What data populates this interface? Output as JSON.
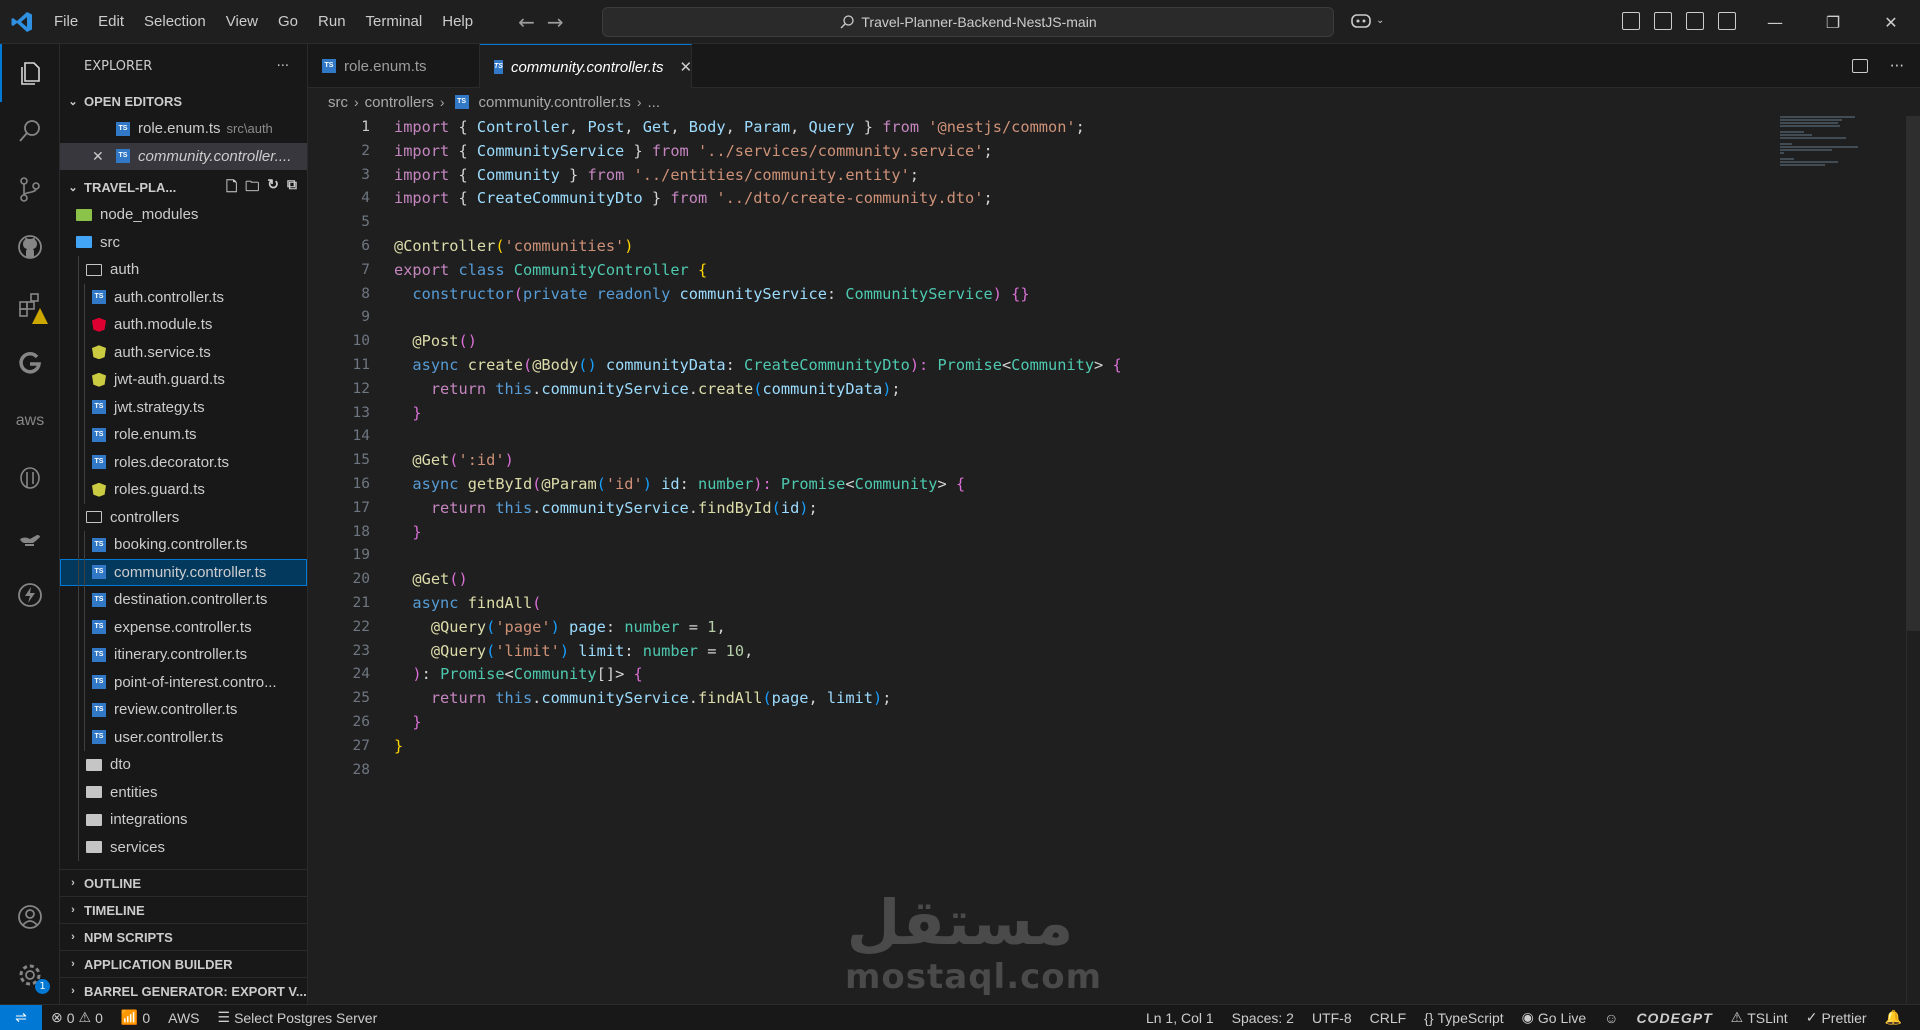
{
  "menu": [
    "File",
    "Edit",
    "Selection",
    "View",
    "Go",
    "Run",
    "Terminal",
    "Help"
  ],
  "command_center": "Travel-Planner-Backend-NestJS-main",
  "sidebar": {
    "title": "EXPLORER",
    "more": "···",
    "open_editors_label": "OPEN EDITORS",
    "open_editors": [
      {
        "name": "role.enum.ts",
        "desc": "src\\auth"
      },
      {
        "name": "community.controller...."
      }
    ],
    "project_label": "TRAVEL-PLA...",
    "tree": {
      "node_modules": "node_modules",
      "src": "src",
      "auth": "auth",
      "auth_files": [
        "auth.controller.ts",
        "auth.module.ts",
        "auth.service.ts",
        "jwt-auth.guard.ts",
        "jwt.strategy.ts",
        "role.enum.ts",
        "roles.decorator.ts",
        "roles.guard.ts"
      ],
      "controllers": "controllers",
      "controller_files": [
        "booking.controller.ts",
        "community.controller.ts",
        "destination.controller.ts",
        "expense.controller.ts",
        "itinerary.controller.ts",
        "point-of-interest.contro...",
        "review.controller.ts",
        "user.controller.ts"
      ],
      "dto": "dto",
      "entities": "entities",
      "integrations": "integrations",
      "services": "services"
    },
    "sections": [
      "OUTLINE",
      "TIMELINE",
      "NPM SCRIPTS",
      "APPLICATION BUILDER",
      "BARREL GENERATOR: EXPORT V..."
    ]
  },
  "tabs": [
    {
      "label": "role.enum.ts",
      "active": false
    },
    {
      "label": "community.controller.ts",
      "active": true
    }
  ],
  "breadcrumb": [
    "src",
    "controllers",
    "community.controller.ts",
    "..."
  ],
  "line_numbers": [
    "1",
    "2",
    "3",
    "4",
    "5",
    "6",
    "7",
    "8",
    "9",
    "10",
    "11",
    "12",
    "13",
    "14",
    "15",
    "16",
    "17",
    "18",
    "19",
    "20",
    "21",
    "22",
    "23",
    "24",
    "25",
    "26",
    "27",
    "28"
  ],
  "code": {
    "l1": {
      "a": "import",
      "b": " { ",
      "c": "Controller",
      "d": ", ",
      "e": "Post",
      "f": ", ",
      "g": "Get",
      "h": ", ",
      "i": "Body",
      "j": ", ",
      "k": "Param",
      "l": ", ",
      "m": "Query",
      "n": " } ",
      "o": "from",
      "p": " ",
      "q": "'@nestjs/common'",
      "r": ";"
    },
    "l2": {
      "a": "import",
      "b": " { ",
      "c": "CommunityService",
      "d": " } ",
      "e": "from",
      "f": " ",
      "g": "'../services/community.service'",
      "h": ";"
    },
    "l3": {
      "a": "import",
      "b": " { ",
      "c": "Community",
      "d": " } ",
      "e": "from",
      "f": " ",
      "g": "'../entities/community.entity'",
      "h": ";"
    },
    "l4": {
      "a": "import",
      "b": " { ",
      "c": "CreateCommunityDto",
      "d": " } ",
      "e": "from",
      "f": " ",
      "g": "'../dto/create-community.dto'",
      "h": ";"
    },
    "l6": {
      "a": "@",
      "b": "Controller",
      "c": "(",
      "d": "'communities'",
      "e": ")"
    },
    "l7": {
      "a": "export",
      "b": " ",
      "c": "class",
      "d": " ",
      "e": "CommunityController",
      "f": " ",
      "g": "{"
    },
    "l8": {
      "a": "  ",
      "b": "constructor",
      "c": "(",
      "d": "private",
      "e": " ",
      "f": "readonly",
      "g": " ",
      "h": "communityService",
      "i": ": ",
      "j": "CommunityService",
      "k": ") ",
      "l": "{}"
    },
    "l10": {
      "a": "  @",
      "b": "Post",
      "c": "()"
    },
    "l11": {
      "a": "  ",
      "b": "async",
      "c": " ",
      "d": "create",
      "e": "(",
      "f": "@",
      "g": "Body",
      "h": "()",
      "i": " ",
      "j": "communityData",
      "k": ": ",
      "l": "CreateCommunityDto",
      "m": "): ",
      "n": "Promise",
      "o": "<",
      "p": "Community",
      "q": "> ",
      "r": "{"
    },
    "l12": {
      "a": "    ",
      "b": "return",
      "c": " ",
      "d": "this",
      "e": ".",
      "f": "communityService",
      "g": ".",
      "h": "create",
      "i": "(",
      "j": "communityData",
      "k": ")",
      "l": ";"
    },
    "l13": {
      "a": "  ",
      "b": "}"
    },
    "l15": {
      "a": "  @",
      "b": "Get",
      "c": "(",
      "d": "':id'",
      "e": ")"
    },
    "l16": {
      "a": "  ",
      "b": "async",
      "c": " ",
      "d": "getById",
      "e": "(",
      "f": "@",
      "g": "Param",
      "h": "(",
      "i": "'id'",
      "j": ")",
      "k": " ",
      "l": "id",
      "m": ": ",
      "n": "number",
      "o": "): ",
      "p": "Promise",
      "q": "<",
      "r": "Community",
      "s": "> ",
      "t": "{"
    },
    "l17": {
      "a": "    ",
      "b": "return",
      "c": " ",
      "d": "this",
      "e": ".",
      "f": "communityService",
      "g": ".",
      "h": "findById",
      "i": "(",
      "j": "id",
      "k": ")",
      "l": ";"
    },
    "l18": {
      "a": "  ",
      "b": "}"
    },
    "l20": {
      "a": "  @",
      "b": "Get",
      "c": "()"
    },
    "l21": {
      "a": "  ",
      "b": "async",
      "c": " ",
      "d": "findAll",
      "e": "("
    },
    "l22": {
      "a": "    @",
      "b": "Query",
      "c": "(",
      "d": "'page'",
      "e": ")",
      "f": " ",
      "g": "page",
      "h": ": ",
      "i": "number",
      "j": " = ",
      "k": "1",
      "l": ","
    },
    "l23": {
      "a": "    @",
      "b": "Query",
      "c": "(",
      "d": "'limit'",
      "e": ")",
      "f": " ",
      "g": "limit",
      "h": ": ",
      "i": "number",
      "j": " = ",
      "k": "10",
      "l": ","
    },
    "l24": {
      "a": "  ",
      "b": ")",
      "c": ": ",
      "d": "Promise",
      "e": "<",
      "f": "Community",
      "g": "[]",
      "h": "> ",
      "i": "{"
    },
    "l25": {
      "a": "    ",
      "b": "return",
      "c": " ",
      "d": "this",
      "e": ".",
      "f": "communityService",
      "g": ".",
      "h": "findAll",
      "i": "(",
      "j": "page",
      "k": ", ",
      "l": "limit",
      "m": ")",
      "n": ";"
    },
    "l26": {
      "a": "  ",
      "b": "}"
    },
    "l27": {
      "a": "}"
    }
  },
  "watermark": {
    "arabic": "مستقل",
    "latin": "mostaql.com"
  },
  "status": {
    "errors": "0",
    "warnings": "0",
    "ports": "0",
    "aws": "AWS",
    "postgres": "Select Postgres Server",
    "position": "Ln 1, Col 1",
    "spaces": "Spaces: 2",
    "encoding": "UTF-8",
    "eol": "CRLF",
    "language": "TypeScript",
    "golive": "Go Live",
    "codegpt": "CODEGPT",
    "tslint": "TSLint",
    "prettier": "Prettier"
  },
  "accounts_badge": "1",
  "colors": {
    "accent": "#0078d4",
    "keyword": "#c586c0",
    "type": "#4ec9b0",
    "string": "#ce9178",
    "function": "#dcdcaa"
  }
}
